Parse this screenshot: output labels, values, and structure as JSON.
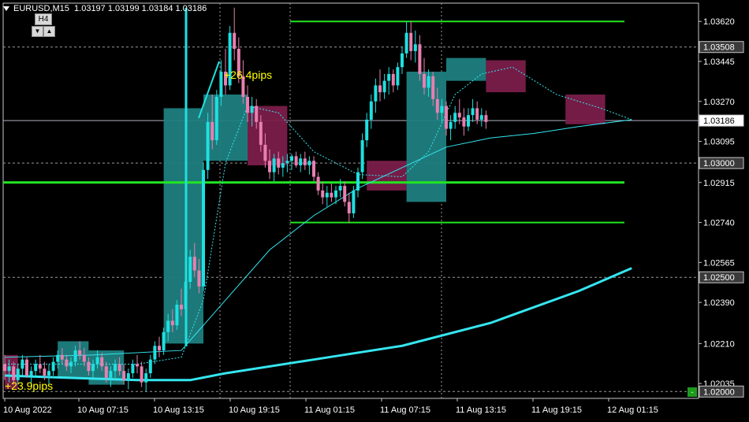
{
  "header": {
    "symbol_tf": "EURUSD,M15",
    "ohlc": "1.03197 1.03199 1.03184 1.03186"
  },
  "timeframe_panel": {
    "label": "H4",
    "down": "▼",
    "up": "▲"
  },
  "annotations": {
    "pips_top": "+26.4pips",
    "pips_bottom": "+23.9pips"
  },
  "corner_button": "-",
  "price_axis": {
    "ticks": [
      "1.03620",
      "1.03445",
      "1.03270",
      "1.03095",
      "1.02915",
      "1.02740",
      "1.02565",
      "1.02390",
      "1.02210",
      "1.02035"
    ],
    "badges": [
      {
        "label": "1.03508",
        "style": "gray"
      },
      {
        "label": "1.03186",
        "style": "white"
      },
      {
        "label": "1.03000",
        "style": "gray"
      },
      {
        "label": "1.02500",
        "style": "gray"
      },
      {
        "label": "1.02000",
        "style": "gray"
      }
    ]
  },
  "time_axis": [
    "10 Aug 2022",
    "10 Aug 07:15",
    "10 Aug 13:15",
    "10 Aug 19:15",
    "11 Aug 01:15",
    "11 Aug 07:15",
    "11 Aug 13:15",
    "11 Aug 19:15",
    "12 Aug 01:15"
  ],
  "colors": {
    "background": "#000000",
    "bull": "#1fe0e0",
    "bear": "#e87fb0",
    "bull_box": "#1f7f7f",
    "bear_box": "#7a1e4a",
    "level_line": "#22e622",
    "ma": "#35e6f0",
    "grid": "#9a9a9a"
  },
  "chart_data": {
    "type": "candlestick",
    "symbol": "EURUSD",
    "timeframe": "M15",
    "ylim": [
      1.0197,
      1.037
    ],
    "current_price": 1.03186,
    "horizontal_levels": [
      1.0362,
      1.02915,
      1.0274
    ],
    "reference_lines": [
      1.03508,
      1.03186,
      1.03,
      1.025,
      1.02
    ],
    "candles": [
      [
        0,
        1.0212,
        1.0216,
        1.0205,
        1.0209
      ],
      [
        1,
        1.0209,
        1.0214,
        1.0204,
        1.0211
      ],
      [
        2,
        1.0211,
        1.0213,
        1.0203,
        1.0205
      ],
      [
        3,
        1.0205,
        1.0212,
        1.0203,
        1.021
      ],
      [
        4,
        1.021,
        1.0216,
        1.0207,
        1.0214
      ],
      [
        5,
        1.0214,
        1.0215,
        1.0206,
        1.0207
      ],
      [
        6,
        1.0207,
        1.0211,
        1.0202,
        1.0209
      ],
      [
        7,
        1.0209,
        1.0214,
        1.0206,
        1.0212
      ],
      [
        8,
        1.0212,
        1.0216,
        1.0208,
        1.021
      ],
      [
        9,
        1.021,
        1.0213,
        1.0205,
        1.0207
      ],
      [
        10,
        1.0207,
        1.0212,
        1.0203,
        1.0209
      ],
      [
        11,
        1.0209,
        1.0215,
        1.0207,
        1.0213
      ],
      [
        12,
        1.0213,
        1.0218,
        1.021,
        1.0216
      ],
      [
        13,
        1.0216,
        1.0219,
        1.0212,
        1.0214
      ],
      [
        14,
        1.0214,
        1.0216,
        1.0209,
        1.0211
      ],
      [
        15,
        1.0211,
        1.0215,
        1.0208,
        1.0213
      ],
      [
        16,
        1.0213,
        1.022,
        1.0211,
        1.0218
      ],
      [
        17,
        1.0218,
        1.0222,
        1.0214,
        1.0216
      ],
      [
        18,
        1.0216,
        1.0219,
        1.0211,
        1.0213
      ],
      [
        19,
        1.0213,
        1.0215,
        1.0207,
        1.0209
      ],
      [
        20,
        1.0209,
        1.0214,
        1.0206,
        1.0212
      ],
      [
        21,
        1.0212,
        1.0218,
        1.021,
        1.0215
      ],
      [
        22,
        1.0215,
        1.0217,
        1.0209,
        1.0211
      ],
      [
        23,
        1.0211,
        1.0213,
        1.0204,
        1.0206
      ],
      [
        24,
        1.0206,
        1.0211,
        1.0202,
        1.0209
      ],
      [
        25,
        1.0209,
        1.0214,
        1.0206,
        1.0212
      ],
      [
        26,
        1.0212,
        1.0215,
        1.0207,
        1.0209
      ],
      [
        27,
        1.0209,
        1.0212,
        1.0203,
        1.0205
      ],
      [
        28,
        1.0205,
        1.021,
        1.0201,
        1.0208
      ],
      [
        29,
        1.0208,
        1.0214,
        1.0206,
        1.0212
      ],
      [
        30,
        1.0212,
        1.0216,
        1.0208,
        1.0211
      ],
      [
        31,
        1.0211,
        1.0213,
        1.0202,
        1.0204
      ],
      [
        32,
        1.0204,
        1.021,
        1.02,
        1.0208
      ],
      [
        33,
        1.0208,
        1.0216,
        1.0206,
        1.0214
      ],
      [
        34,
        1.0214,
        1.0222,
        1.0212,
        1.022
      ],
      [
        35,
        1.022,
        1.0224,
        1.0215,
        1.0218
      ],
      [
        36,
        1.0218,
        1.0228,
        1.0216,
        1.0226
      ],
      [
        37,
        1.0226,
        1.0234,
        1.0222,
        1.0231
      ],
      [
        38,
        1.0231,
        1.0236,
        1.0226,
        1.0229
      ],
      [
        39,
        1.0229,
        1.024,
        1.0227,
        1.0238
      ],
      [
        40,
        1.0238,
        1.0245,
        1.0233,
        1.0236
      ],
      [
        41,
        1.0236,
        1.025,
        1.0234,
        1.0248
      ],
      [
        42,
        1.0248,
        1.0262,
        1.0245,
        1.0259
      ],
      [
        43,
        1.0259,
        1.0265,
        1.025,
        1.0253
      ],
      [
        44,
        1.0253,
        1.0258,
        1.0243,
        1.0246
      ],
      [
        45,
        1.0246,
        1.03,
        1.0244,
        1.0297
      ],
      [
        46,
        1.0297,
        1.0322,
        1.0293,
        1.0318
      ],
      [
        47,
        1.0318,
        1.033,
        1.0306,
        1.031
      ],
      [
        48,
        1.031,
        1.0332,
        1.0308,
        1.0329
      ],
      [
        49,
        1.0329,
        1.0345,
        1.0325,
        1.034
      ],
      [
        50,
        1.034,
        1.035,
        1.033,
        1.0334
      ],
      [
        51,
        1.0334,
        1.036,
        1.0332,
        1.0357
      ],
      [
        52,
        1.0357,
        1.0368,
        1.0345,
        1.035
      ],
      [
        53,
        1.035,
        1.0355,
        1.0335,
        1.0338
      ],
      [
        54,
        1.0338,
        1.0345,
        1.0326,
        1.0329
      ],
      [
        55,
        1.0329,
        1.0334,
        1.0318,
        1.0322
      ],
      [
        56,
        1.0322,
        1.0329,
        1.0316,
        1.0325
      ],
      [
        57,
        1.0325,
        1.0328,
        1.0315,
        1.0318
      ],
      [
        58,
        1.0318,
        1.0321,
        1.0305,
        1.0308
      ],
      [
        59,
        1.0308,
        1.0313,
        1.0298,
        1.0301
      ],
      [
        60,
        1.0301,
        1.0306,
        1.0293,
        1.0296
      ],
      [
        61,
        1.0296,
        1.0304,
        1.0292,
        1.0302
      ],
      [
        62,
        1.0302,
        1.0305,
        1.0295,
        1.0298
      ],
      [
        63,
        1.0298,
        1.0303,
        1.0294,
        1.03
      ],
      [
        64,
        1.03,
        1.0304,
        1.0296,
        1.0301
      ],
      [
        65,
        1.0301,
        1.0304,
        1.0297,
        1.0303
      ],
      [
        66,
        1.0303,
        1.0305,
        1.0298,
        1.0299
      ],
      [
        67,
        1.0299,
        1.0304,
        1.0296,
        1.0302
      ],
      [
        68,
        1.0302,
        1.0305,
        1.0297,
        1.0299
      ],
      [
        69,
        1.0299,
        1.0303,
        1.0295,
        1.0301
      ],
      [
        70,
        1.0301,
        1.0303,
        1.0292,
        1.0294
      ],
      [
        71,
        1.0294,
        1.0296,
        1.0286,
        1.0288
      ],
      [
        72,
        1.0288,
        1.0292,
        1.0282,
        1.0285
      ],
      [
        73,
        1.0285,
        1.029,
        1.0281,
        1.0287
      ],
      [
        74,
        1.0287,
        1.0291,
        1.0283,
        1.0285
      ],
      [
        75,
        1.0285,
        1.029,
        1.0282,
        1.0288
      ],
      [
        76,
        1.0288,
        1.0293,
        1.0285,
        1.029
      ],
      [
        77,
        1.029,
        1.0292,
        1.0281,
        1.0283
      ],
      [
        78,
        1.0283,
        1.0287,
        1.0274,
        1.0278
      ],
      [
        79,
        1.0278,
        1.029,
        1.0276,
        1.0288
      ],
      [
        80,
        1.0288,
        1.0298,
        1.0285,
        1.0296
      ],
      [
        81,
        1.0296,
        1.0313,
        1.0293,
        1.031
      ],
      [
        82,
        1.031,
        1.0322,
        1.0307,
        1.0319
      ],
      [
        83,
        1.0319,
        1.033,
        1.0315,
        1.0327
      ],
      [
        84,
        1.0327,
        1.0337,
        1.0322,
        1.0334
      ],
      [
        85,
        1.0334,
        1.0341,
        1.0327,
        1.0331
      ],
      [
        86,
        1.0331,
        1.0339,
        1.0328,
        1.0336
      ],
      [
        87,
        1.0336,
        1.0342,
        1.033,
        1.0339
      ],
      [
        88,
        1.0339,
        1.0341,
        1.0331,
        1.0334
      ],
      [
        89,
        1.0334,
        1.0344,
        1.0332,
        1.0342
      ],
      [
        90,
        1.0342,
        1.0351,
        1.0339,
        1.0348
      ],
      [
        91,
        1.0348,
        1.0362,
        1.0346,
        1.0357
      ],
      [
        92,
        1.0357,
        1.0362,
        1.0345,
        1.0349
      ],
      [
        93,
        1.0349,
        1.0358,
        1.0344,
        1.0352
      ],
      [
        94,
        1.0352,
        1.0356,
        1.0336,
        1.0339
      ],
      [
        95,
        1.0339,
        1.0346,
        1.033,
        1.0333
      ],
      [
        96,
        1.0333,
        1.0341,
        1.0329,
        1.0338
      ],
      [
        97,
        1.0338,
        1.034,
        1.0325,
        1.0328
      ],
      [
        98,
        1.0328,
        1.0333,
        1.0319,
        1.0322
      ],
      [
        99,
        1.0322,
        1.0328,
        1.0318,
        1.0325
      ],
      [
        100,
        1.0325,
        1.0327,
        1.0312,
        1.0315
      ],
      [
        101,
        1.0315,
        1.0321,
        1.031,
        1.0318
      ],
      [
        102,
        1.0318,
        1.0325,
        1.0315,
        1.0322
      ],
      [
        103,
        1.0322,
        1.0328,
        1.0317,
        1.032
      ],
      [
        104,
        1.032,
        1.0324,
        1.0312,
        1.0316
      ],
      [
        105,
        1.0316,
        1.0324,
        1.0314,
        1.0321
      ],
      [
        106,
        1.0321,
        1.0328,
        1.0318,
        1.0324
      ],
      [
        107,
        1.0324,
        1.0327,
        1.0317,
        1.0319
      ],
      [
        108,
        1.0319,
        1.0324,
        1.0316,
        1.0321
      ],
      [
        109,
        1.0321,
        1.0323,
        1.0315,
        1.0318
      ]
    ],
    "boxes": [
      {
        "from": 0,
        "to": 3,
        "hi": 1.0216,
        "lo": 1.0201,
        "dir": "bear"
      },
      {
        "from": 12,
        "to": 19,
        "hi": 1.0222,
        "lo": 1.0206,
        "dir": "bull"
      },
      {
        "from": 19,
        "to": 27,
        "hi": 1.0218,
        "lo": 1.0203,
        "dir": "bull"
      },
      {
        "from": 36,
        "to": 45,
        "hi": 1.0324,
        "lo": 1.0221,
        "dir": "bull"
      },
      {
        "from": 45,
        "to": 55,
        "hi": 1.033,
        "lo": 1.0301,
        "dir": "bull"
      },
      {
        "from": 55,
        "to": 64,
        "hi": 1.0325,
        "lo": 1.0299,
        "dir": "bear"
      },
      {
        "from": 82,
        "to": 91,
        "hi": 1.0301,
        "lo": 1.0288,
        "dir": "bear"
      },
      {
        "from": 91,
        "to": 100,
        "hi": 1.034,
        "lo": 1.0283,
        "dir": "bull"
      },
      {
        "from": 100,
        "to": 109,
        "hi": 1.0346,
        "lo": 1.0336,
        "dir": "bull"
      },
      {
        "from": 109,
        "to": 118,
        "hi": 1.0345,
        "lo": 1.0331,
        "dir": "bear"
      },
      {
        "from": 127,
        "to": 136,
        "hi": 1.033,
        "lo": 1.0317,
        "dir": "bear"
      }
    ],
    "ma_fast": [
      [
        0,
        1.0212
      ],
      [
        30,
        1.0212
      ],
      [
        40,
        1.0215
      ],
      [
        45,
        1.024
      ],
      [
        50,
        1.03
      ],
      [
        55,
        1.0325
      ],
      [
        62,
        1.0322
      ],
      [
        70,
        1.0305
      ],
      [
        80,
        1.0295
      ],
      [
        90,
        1.0294
      ],
      [
        96,
        1.0305
      ],
      [
        102,
        1.033
      ],
      [
        108,
        1.0339
      ],
      [
        115,
        1.0342
      ],
      [
        125,
        1.033
      ],
      [
        135,
        1.0324
      ],
      [
        142,
        1.0319
      ]
    ],
    "ma_mid": [
      [
        0,
        1.0215
      ],
      [
        20,
        1.0216
      ],
      [
        40,
        1.0218
      ],
      [
        50,
        1.024
      ],
      [
        60,
        1.0262
      ],
      [
        70,
        1.0277
      ],
      [
        80,
        1.0289
      ],
      [
        90,
        1.0298
      ],
      [
        100,
        1.0307
      ],
      [
        110,
        1.0311
      ],
      [
        120,
        1.0313
      ],
      [
        130,
        1.0316
      ],
      [
        142,
        1.0319
      ]
    ],
    "ma_slow": [
      [
        0,
        1.0207
      ],
      [
        30,
        1.0205
      ],
      [
        42,
        1.0205
      ],
      [
        50,
        1.0208
      ],
      [
        70,
        1.0214
      ],
      [
        90,
        1.022
      ],
      [
        110,
        1.023
      ],
      [
        130,
        1.0244
      ],
      [
        142,
        1.0254
      ]
    ]
  }
}
